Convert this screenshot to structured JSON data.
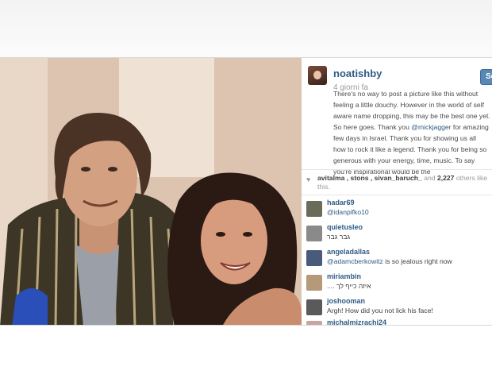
{
  "post": {
    "username": "noatishby",
    "time_ago": "4 giorni fa",
    "follow_label": "Segui",
    "caption_before": "There's no way to post a picture like this without feeling a little douchy. However in the world of self aware name dropping, this may be the best one yet. So here goes. Thank you ",
    "caption_mention": "@mickjagger",
    "caption_after": " for amazing few days in Israel. Thank you for showing us all how to rock it like a legend. Thank you for being so generous with your energy, time, music. To say you're inspirational would be the"
  },
  "likes": {
    "users": "avitalma , stons , sivan_baruch_",
    "between": " and ",
    "count": "2,227",
    "suffix": " others like this."
  },
  "comments": [
    {
      "user": "hadar69",
      "mention": "@idanpifko10",
      "text": "",
      "avatar_color": "#6b6b5a"
    },
    {
      "user": "quietusleo",
      "mention": "",
      "text": "גבר גבר",
      "avatar_color": "#8a8a8a"
    },
    {
      "user": "angeladallas",
      "mention": "@adamcberkowitz",
      "text": " is so jealous right now",
      "avatar_color": "#4a5a7a"
    },
    {
      "user": "miriambin",
      "mention": "",
      "text": "איזה כייף לך ....",
      "avatar_color": "#b59a7a"
    },
    {
      "user": "joshooman",
      "mention": "",
      "text": "Argh! How did you not lick his face!",
      "avatar_color": "#5a5a5a"
    },
    {
      "user": "michalmizrachi24",
      "mention": "",
      "text": "",
      "avatar_color": "#c9a5a0"
    }
  ],
  "colors": {
    "link": "#2f5b85",
    "follow_button": "#5a88b5"
  },
  "icons": {
    "like": "heart-icon"
  }
}
